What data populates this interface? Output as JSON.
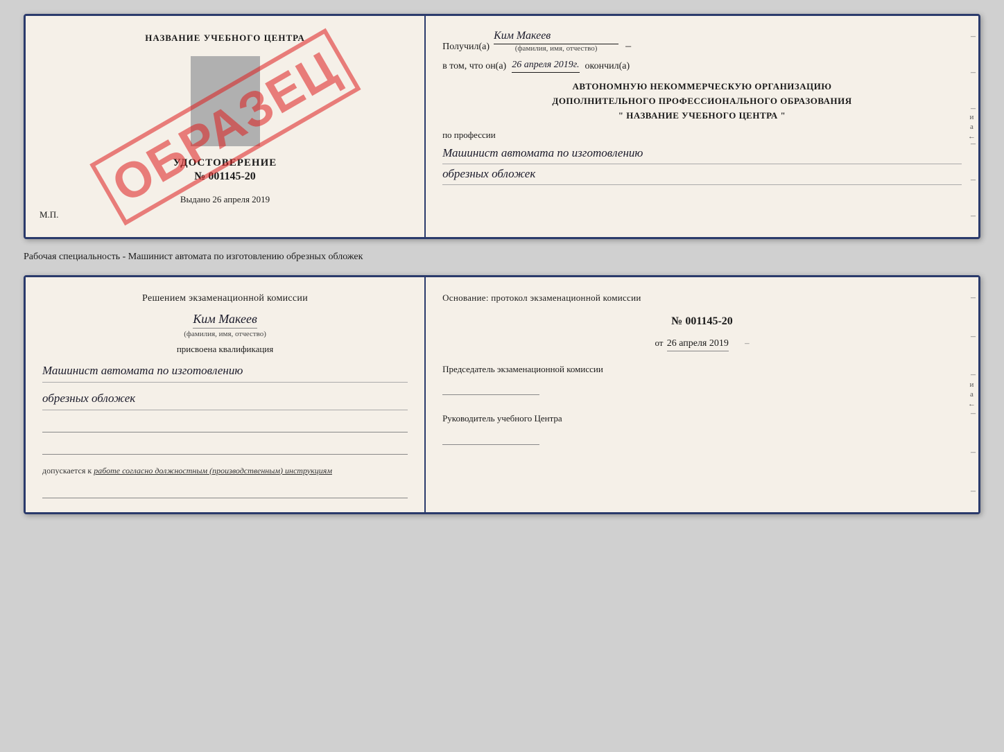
{
  "top_doc": {
    "left": {
      "title": "НАЗВАНИЕ УЧЕБНОГО ЦЕНТРА",
      "watermark": "ОБРАЗЕЦ",
      "udost_label": "УДОСТОВЕРЕНИЕ",
      "udost_number": "№ 001145-20",
      "vydano_text": "Выдано",
      "vydano_date": "26 апреля 2019",
      "mp_label": "М.П."
    },
    "right": {
      "poluchil_prefix": "Получил(а)",
      "recipient_name": "Ким Макеев",
      "fio_label": "(фамилия, имя, отчество)",
      "vtom_prefix": "в том, что он(а)",
      "date_value": "26 апреля 2019г.",
      "okonchil": "окончил(а)",
      "org_line1": "АВТОНОМНУЮ НЕКОММЕРЧЕСКУЮ ОРГАНИЗАЦИЮ",
      "org_line2": "ДОПОЛНИТЕЛЬНОГО ПРОФЕССИОНАЛЬНОГО ОБРАЗОВАНИЯ",
      "org_line3": "\"   НАЗВАНИЕ УЧЕБНОГО ЦЕНТРА   \"",
      "po_professii": "по профессии",
      "profession_line1": "Машинист автомата по изготовлению",
      "profession_line2": "обрезных обложек"
    }
  },
  "separator": {
    "text": "Рабочая специальность - Машинист автомата по изготовлению обрезных обложек"
  },
  "bottom_doc": {
    "left": {
      "resheniem_text": "Решением экзаменационной комиссии",
      "person_name": "Ким Макеев",
      "fio_label": "(фамилия, имя, отчество)",
      "prisvoena": "присвоена квалификация",
      "kvalif_line1": "Машинист автомата по изготовлению",
      "kvalif_line2": "обрезных обложек",
      "dopuskaetsya_prefix": "допускается к",
      "dopuskaetsya_italic": "работе согласно должностным (производственным) инструкциям"
    },
    "right": {
      "osnov_text": "Основание: протокол экзаменационной комиссии",
      "protocol_number": "№  001145-20",
      "ot_prefix": "от",
      "protocol_date": "26 апреля 2019",
      "predsedatel_label": "Председатель экзаменационной комиссии",
      "rukovoditel_label": "Руководитель учебного Центра"
    }
  }
}
